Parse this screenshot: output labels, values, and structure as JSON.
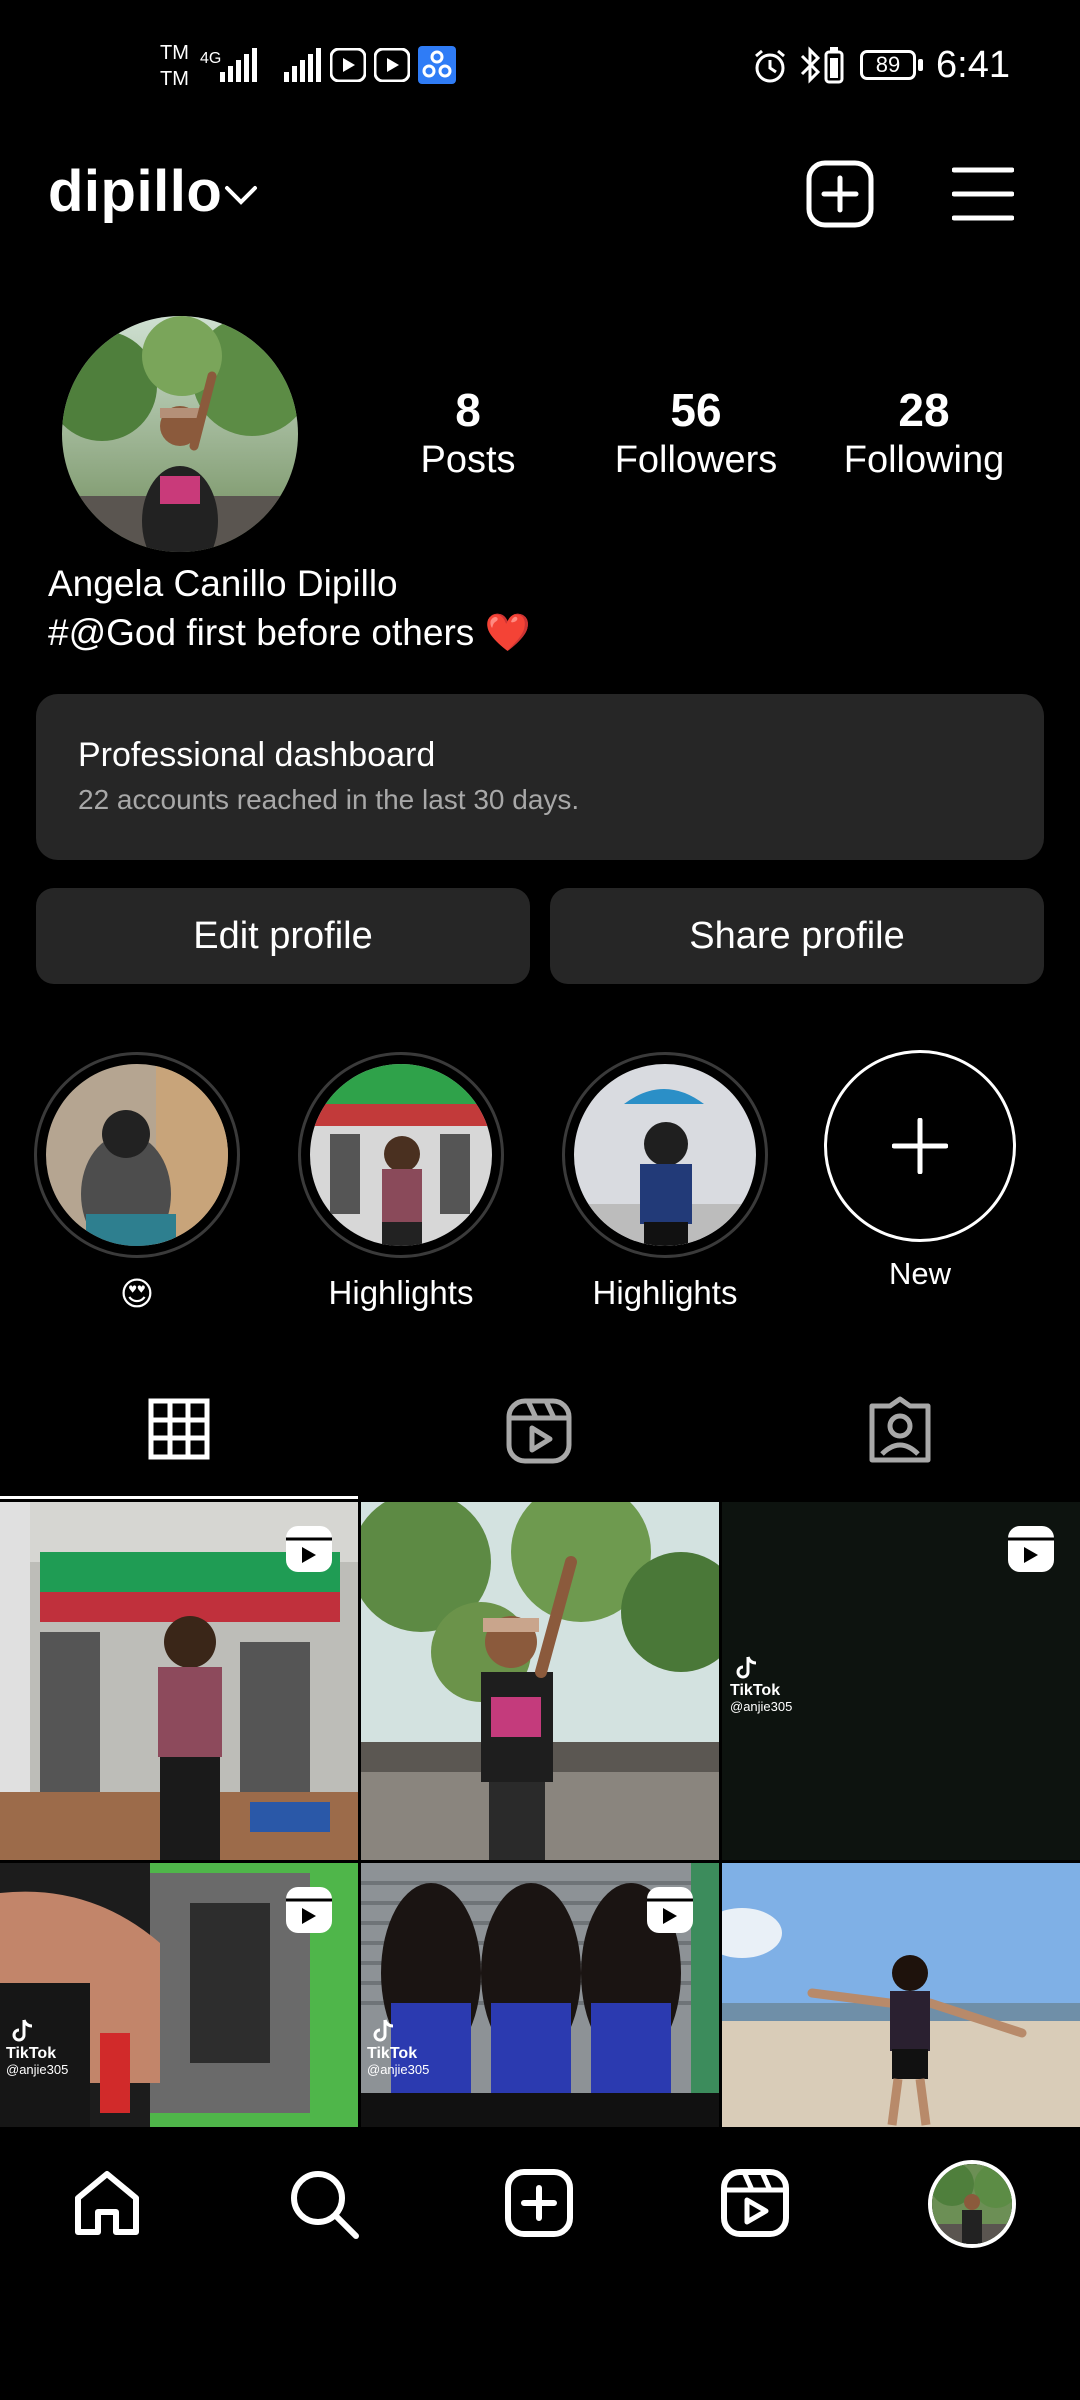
{
  "status_bar": {
    "carrier_1": "TM",
    "carrier_2": "TM",
    "network": "4G",
    "battery": "89",
    "time": "6:41"
  },
  "header": {
    "username": "dipillo"
  },
  "profile": {
    "stats": [
      {
        "value": "8",
        "label": "Posts"
      },
      {
        "value": "56",
        "label": "Followers"
      },
      {
        "value": "28",
        "label": "Following"
      }
    ],
    "full_name": "Angela Canillo Dipillo",
    "bio": "#@God first before others ❤️"
  },
  "dashboard": {
    "title": "Professional dashboard",
    "subtitle": "22 accounts reached in the last 30 days."
  },
  "actions": {
    "edit": "Edit profile",
    "share": "Share profile"
  },
  "highlights": [
    {
      "label": "😍"
    },
    {
      "label": "Highlights"
    },
    {
      "label": "Highlights"
    },
    {
      "label": "New"
    }
  ],
  "grid": {
    "tiktok_brand": "TikTok",
    "tiktok_handle": "@anjie305"
  },
  "colors": {
    "background": "#000000",
    "card": "#262626",
    "muted_text": "#a8a8a8",
    "heart": "#ff3040"
  }
}
